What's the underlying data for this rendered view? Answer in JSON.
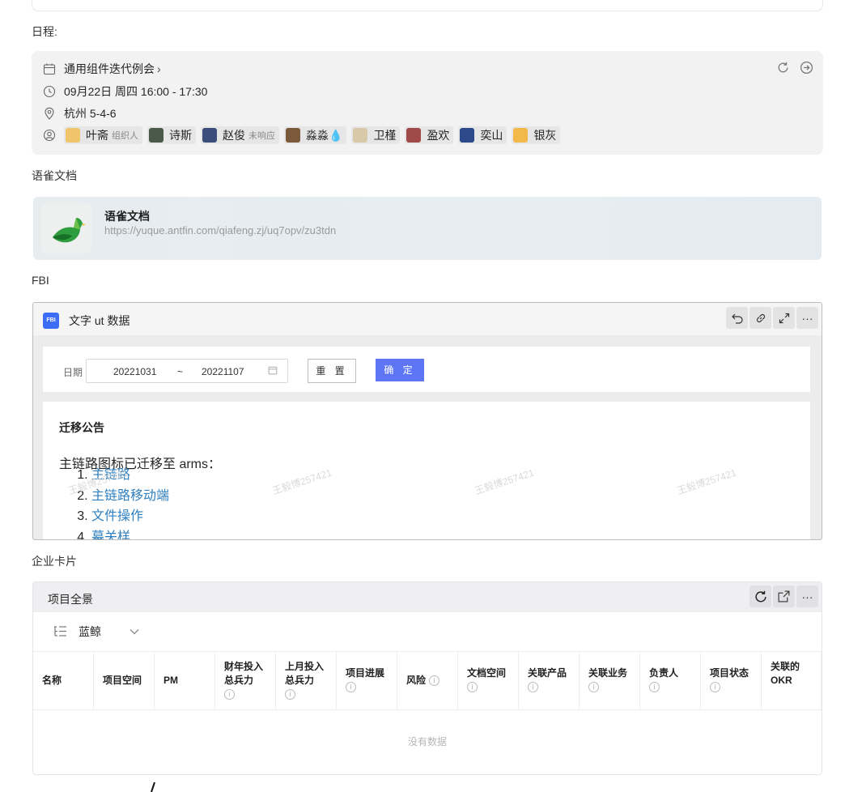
{
  "schedule_label": "日程:",
  "schedule": {
    "title": "通用组件迭代例会",
    "time": "09月22日 周四 16:00 - 17:30",
    "location": "杭州 5-4-6",
    "attendees": [
      {
        "name": "叶斋",
        "tag": "组织人",
        "color": "#f0c46a"
      },
      {
        "name": "诗斯",
        "tag": "",
        "color": "#4a5a4a"
      },
      {
        "name": "赵俊",
        "tag": "未响应",
        "color": "#3b4d7a"
      },
      {
        "name": "淼淼💧",
        "tag": "",
        "color": "#7a5a3a"
      },
      {
        "name": "卫槿",
        "tag": "",
        "color": "#d8c9a8"
      },
      {
        "name": "盈欢",
        "tag": "",
        "color": "#a04a4a"
      },
      {
        "name": "奕山",
        "tag": "",
        "color": "#2c4a8a"
      },
      {
        "name": "银灰",
        "tag": "",
        "color": "#f2b94a"
      }
    ]
  },
  "yuque_label": "语雀文档",
  "yuque": {
    "title": "语雀文档",
    "url": "https://yuque.antfin.com/qiafeng.zj/uq7opv/zu3tdn"
  },
  "fbi_label": "FBI",
  "fbi": {
    "badge": "FBI",
    "title": "文字 ut 数据",
    "date_label": "日期",
    "date_start": "20221031",
    "date_sep": "~",
    "date_end": "20221107",
    "reset": "重 置",
    "confirm": "确 定",
    "notice_title": "迁移公告",
    "notice_text": "主链路图标已迁移至 arms：",
    "links": [
      "主链路",
      "主链路移动端",
      "文件操作",
      "幕关样"
    ],
    "watermark": "王毅博257421"
  },
  "enterprise_label": "企业卡片",
  "project": {
    "title": "项目全景",
    "selector": "蓝鲸",
    "columns": [
      {
        "label": "名称",
        "info": false
      },
      {
        "label": "项目空间",
        "info": false
      },
      {
        "label": "PM",
        "info": false
      },
      {
        "label": "财年投入总兵力",
        "info": true
      },
      {
        "label": "上月投入总兵力",
        "info": true
      },
      {
        "label": "项目进展",
        "info": true
      },
      {
        "label": "风险",
        "info": true
      },
      {
        "label": "文档空间",
        "info": true
      },
      {
        "label": "关联产品",
        "info": true
      },
      {
        "label": "关联业务",
        "info": true
      },
      {
        "label": "负责人",
        "info": true
      },
      {
        "label": "项目状态",
        "info": true
      },
      {
        "label": "关联的OKR",
        "info": false
      }
    ],
    "empty_text": "没有数据"
  },
  "colors": {
    "accent": "#5e76f5",
    "link": "#2f7fbf",
    "fbi_badge": "#3d6cf6"
  }
}
